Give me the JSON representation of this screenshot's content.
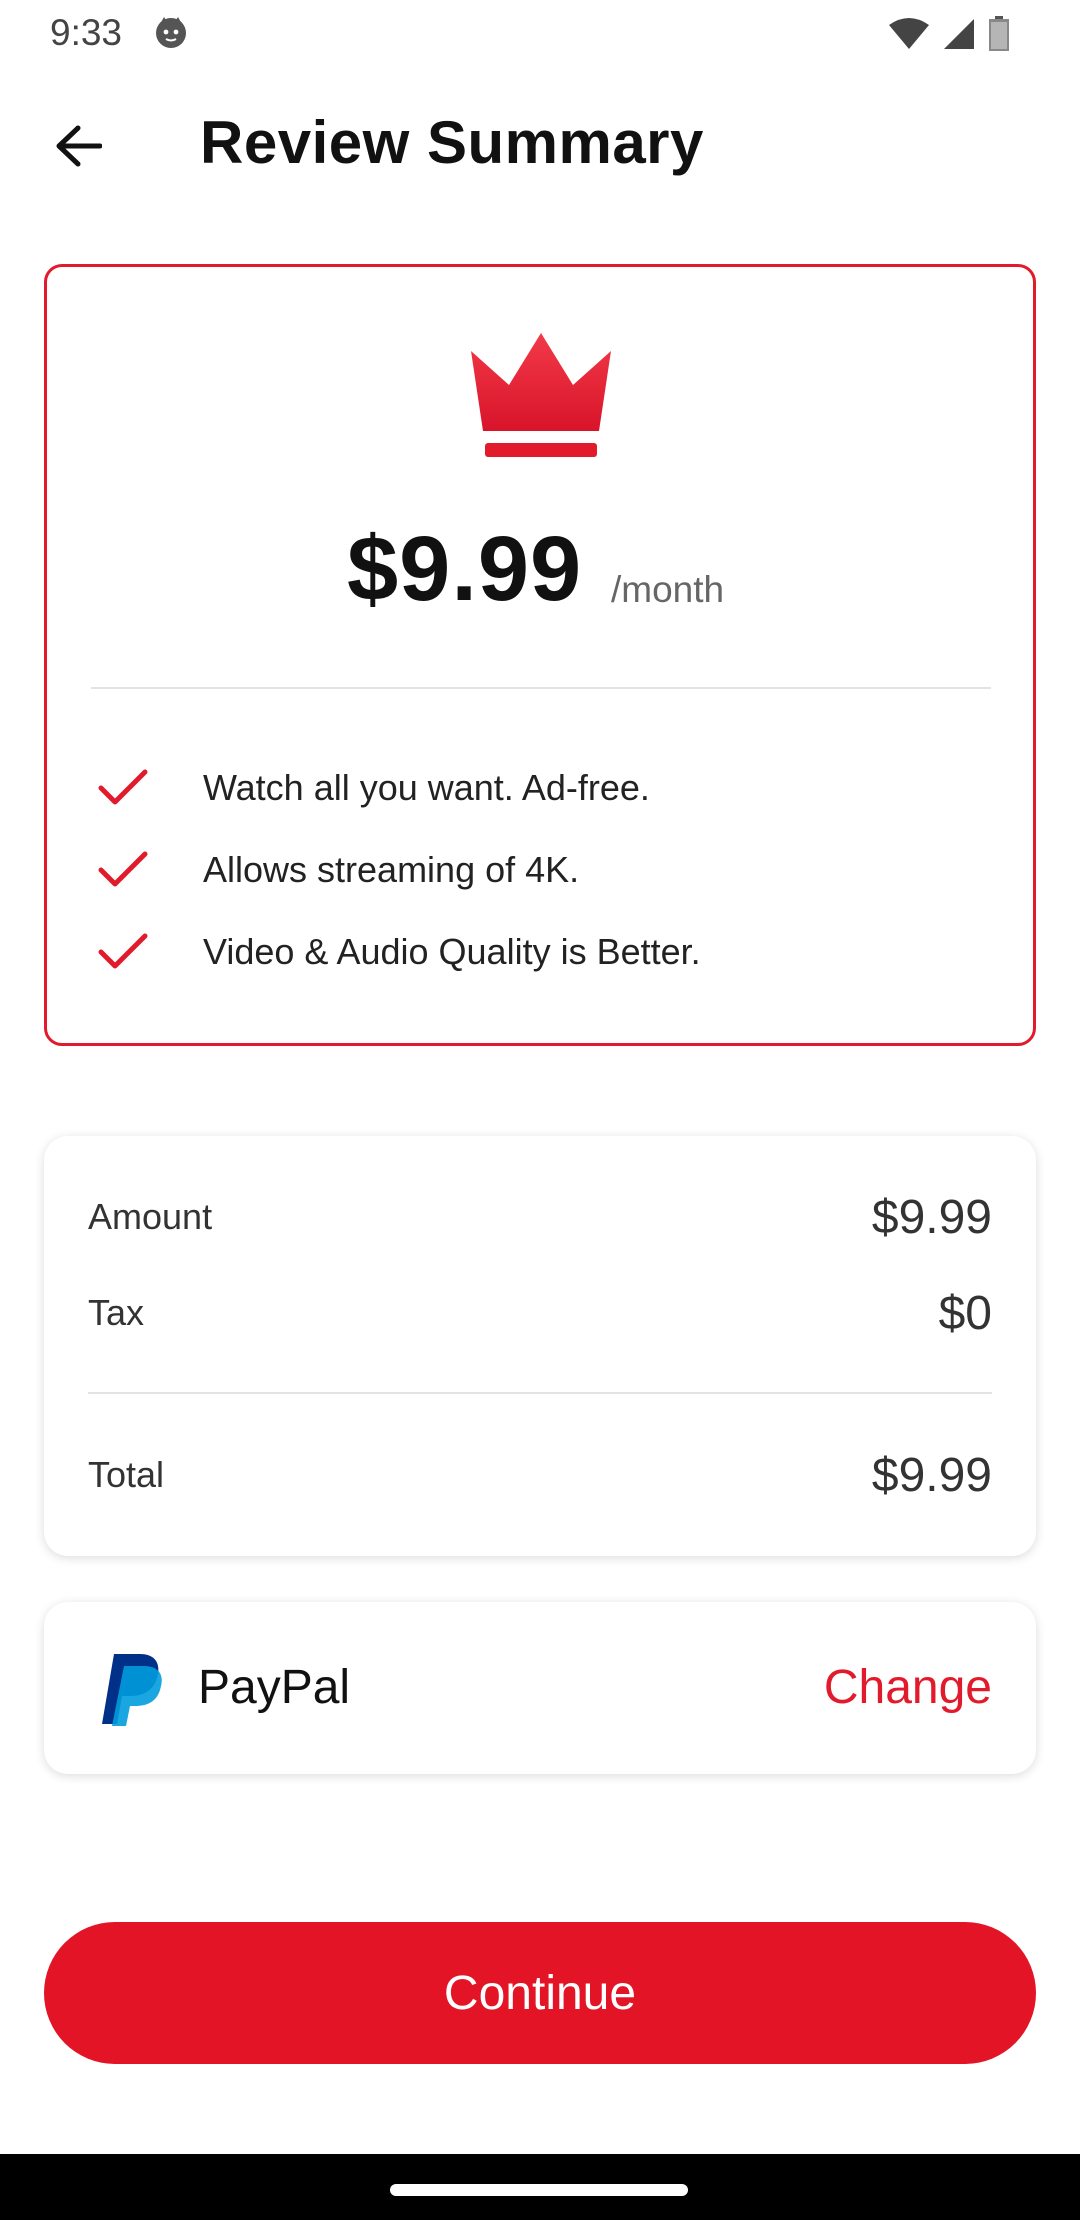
{
  "status_bar": {
    "time": "9:33",
    "icons": [
      "cat-notification-icon",
      "wifi-icon",
      "signal-icon",
      "battery-icon"
    ]
  },
  "header": {
    "title": "Review Summary",
    "back_icon": "arrow-left-icon"
  },
  "plan": {
    "icon": "crown-icon",
    "price": "$9.99",
    "period": "/month",
    "features": [
      "Watch all you want. Ad-free.",
      "Allows streaming of 4K.",
      "Video & Audio Quality is Better."
    ]
  },
  "summary": {
    "amount_label": "Amount",
    "amount_value": "$9.99",
    "tax_label": "Tax",
    "tax_value": "$0",
    "total_label": "Total",
    "total_value": "$9.99"
  },
  "payment": {
    "method": "PayPal",
    "icon": "paypal-logo",
    "change_label": "Change"
  },
  "actions": {
    "continue_label": "Continue"
  },
  "colors": {
    "accent": "#e21426",
    "border": "#e21b2c",
    "paypal_dark": "#003087",
    "paypal_light": "#009cde"
  }
}
